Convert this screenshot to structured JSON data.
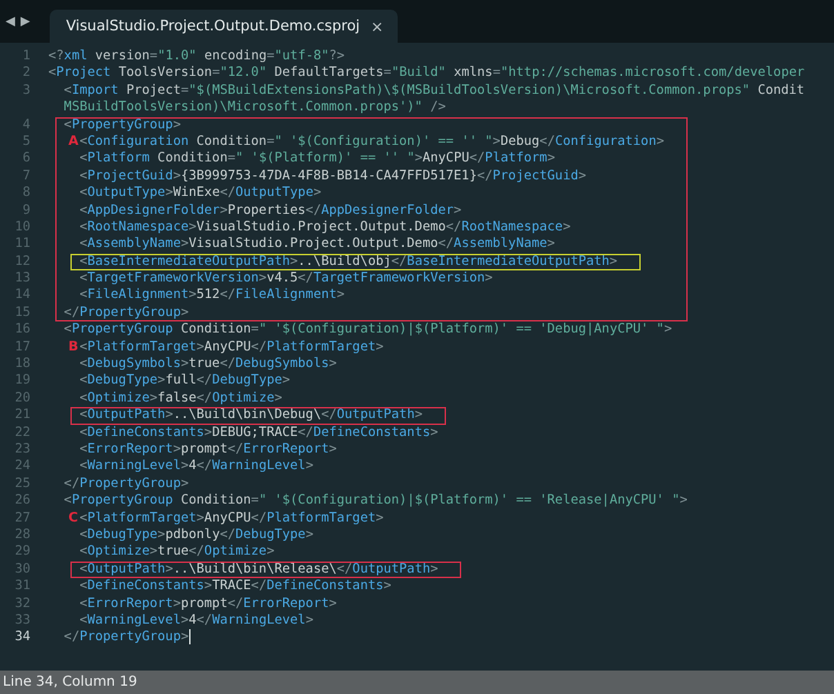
{
  "nav": {
    "back": "◀",
    "forward": "▶"
  },
  "tab": {
    "title": "VisualStudio.Project.Output.Demo.csproj",
    "close": "×",
    "selected": true
  },
  "lines": [
    {
      "kind": "line",
      "number": "1",
      "current": false,
      "rows": [
        "<?xml version=\"1.0\" encoding=\"utf-8\"?>"
      ]
    },
    {
      "kind": "line",
      "number": "2",
      "current": false,
      "rows": [
        "<Project ToolsVersion=\"12.0\" DefaultTargets=\"Build\" xmlns=\"http://schemas.microsoft.com/developer"
      ]
    },
    {
      "kind": "line",
      "number": "3",
      "current": false,
      "rows": [
        "  <Import Project=\"$(MSBuildExtensionsPath)\\$(MSBuildToolsVersion)\\Microsoft.Common.props\" Condit",
        "  MSBuildToolsVersion)\\Microsoft.Common.props')\" />"
      ]
    },
    {
      "kind": "box",
      "color": "#d8304a",
      "lines": [
        {
          "kind": "line",
          "number": "4",
          "current": false,
          "rows": [
            "  <PropertyGroup>"
          ]
        },
        {
          "kind": "line",
          "number": "5",
          "current": false,
          "marker": "A",
          "rows": [
            "    <Configuration Condition=\" '$(Configuration)' == '' \">Debug</Configuration>"
          ]
        },
        {
          "kind": "line",
          "number": "6",
          "current": false,
          "rows": [
            "    <Platform Condition=\" '$(Platform)' == '' \">AnyCPU</Platform>"
          ]
        },
        {
          "kind": "line",
          "number": "7",
          "current": false,
          "rows": [
            "    <ProjectGuid>{3B999753-47DA-4F8B-BB14-CA47FFD517E1}</ProjectGuid>"
          ]
        },
        {
          "kind": "line",
          "number": "8",
          "current": false,
          "rows": [
            "    <OutputType>WinExe</OutputType>"
          ]
        },
        {
          "kind": "line",
          "number": "9",
          "current": false,
          "rows": [
            "    <AppDesignerFolder>Properties</AppDesignerFolder>"
          ]
        },
        {
          "kind": "line",
          "number": "10",
          "current": false,
          "rows": [
            "    <RootNamespace>VisualStudio.Project.Output.Demo</RootNamespace>"
          ]
        },
        {
          "kind": "line",
          "number": "11",
          "current": false,
          "rows": [
            "    <AssemblyName>VisualStudio.Project.Output.Demo</AssemblyName>"
          ]
        },
        {
          "kind": "box",
          "color": "#c8d030",
          "lines": [
            {
              "kind": "line",
              "number": "12",
              "current": false,
              "rows": [
                "    <BaseIntermediateOutputPath>..\\Build\\obj</BaseIntermediateOutputPath>"
              ]
            }
          ]
        },
        {
          "kind": "line",
          "number": "13",
          "current": false,
          "rows": [
            "    <TargetFrameworkVersion>v4.5</TargetFrameworkVersion>"
          ]
        },
        {
          "kind": "line",
          "number": "14",
          "current": false,
          "rows": [
            "    <FileAlignment>512</FileAlignment>"
          ]
        },
        {
          "kind": "line",
          "number": "15",
          "current": false,
          "rows": [
            "  </PropertyGroup>"
          ]
        }
      ]
    },
    {
      "kind": "line",
      "number": "16",
      "current": false,
      "rows": [
        "  <PropertyGroup Condition=\" '$(Configuration)|$(Platform)' == 'Debug|AnyCPU' \">"
      ]
    },
    {
      "kind": "line",
      "number": "17",
      "current": false,
      "marker": "B",
      "rows": [
        "    <PlatformTarget>AnyCPU</PlatformTarget>"
      ]
    },
    {
      "kind": "line",
      "number": "18",
      "current": false,
      "rows": [
        "    <DebugSymbols>true</DebugSymbols>"
      ]
    },
    {
      "kind": "line",
      "number": "19",
      "current": false,
      "rows": [
        "    <DebugType>full</DebugType>"
      ]
    },
    {
      "kind": "line",
      "number": "20",
      "current": false,
      "rows": [
        "    <Optimize>false</Optimize>"
      ]
    },
    {
      "kind": "box",
      "color": "#d8304a",
      "lines": [
        {
          "kind": "line",
          "number": "21",
          "current": false,
          "rows": [
            "    <OutputPath>..\\Build\\bin\\Debug\\</OutputPath>"
          ]
        }
      ]
    },
    {
      "kind": "line",
      "number": "22",
      "current": false,
      "rows": [
        "    <DefineConstants>DEBUG;TRACE</DefineConstants>"
      ]
    },
    {
      "kind": "line",
      "number": "23",
      "current": false,
      "rows": [
        "    <ErrorReport>prompt</ErrorReport>"
      ]
    },
    {
      "kind": "line",
      "number": "24",
      "current": false,
      "rows": [
        "    <WarningLevel>4</WarningLevel>"
      ]
    },
    {
      "kind": "line",
      "number": "25",
      "current": false,
      "rows": [
        "  </PropertyGroup>"
      ]
    },
    {
      "kind": "line",
      "number": "26",
      "current": false,
      "rows": [
        "  <PropertyGroup Condition=\" '$(Configuration)|$(Platform)' == 'Release|AnyCPU' \">"
      ]
    },
    {
      "kind": "line",
      "number": "27",
      "current": false,
      "marker": "C",
      "rows": [
        "    <PlatformTarget>AnyCPU</PlatformTarget>"
      ]
    },
    {
      "kind": "line",
      "number": "28",
      "current": false,
      "rows": [
        "    <DebugType>pdbonly</DebugType>"
      ]
    },
    {
      "kind": "line",
      "number": "29",
      "current": false,
      "rows": [
        "    <Optimize>true</Optimize>"
      ]
    },
    {
      "kind": "box",
      "color": "#d8304a",
      "lines": [
        {
          "kind": "line",
          "number": "30",
          "current": false,
          "rows": [
            "    <OutputPath>..\\Build\\bin\\Release\\</OutputPath>"
          ]
        }
      ]
    },
    {
      "kind": "line",
      "number": "31",
      "current": false,
      "rows": [
        "    <DefineConstants>TRACE</DefineConstants>"
      ]
    },
    {
      "kind": "line",
      "number": "32",
      "current": false,
      "rows": [
        "    <ErrorReport>prompt</ErrorReport>"
      ]
    },
    {
      "kind": "line",
      "number": "33",
      "current": false,
      "rows": [
        "    <WarningLevel>4</WarningLevel>"
      ]
    },
    {
      "kind": "line",
      "number": "34",
      "current": true,
      "rows": [
        "  </PropertyGroup>"
      ]
    }
  ],
  "status_bar": {
    "text": "Line 34, Column 19"
  }
}
